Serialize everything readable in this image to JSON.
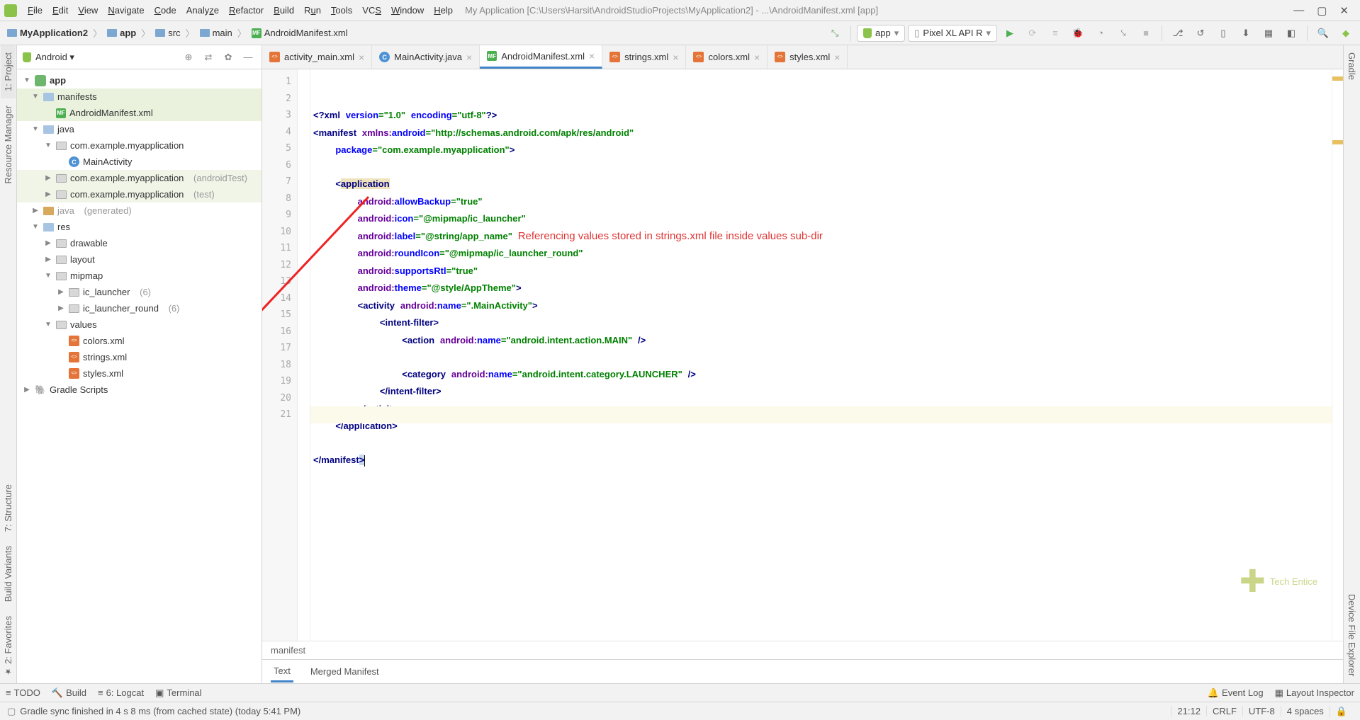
{
  "menu": {
    "items": [
      "File",
      "Edit",
      "View",
      "Navigate",
      "Code",
      "Analyze",
      "Refactor",
      "Build",
      "Run",
      "Tools",
      "VCS",
      "Window",
      "Help"
    ],
    "title": "My Application [C:\\Users\\Harsit\\AndroidStudioProjects\\MyApplication2] - ...\\AndroidManifest.xml [app]"
  },
  "breadcrumb": {
    "items": [
      "MyApplication2",
      "app",
      "src",
      "main",
      "AndroidManifest.xml"
    ]
  },
  "runconfig": {
    "app": "app",
    "device": "Pixel XL API R"
  },
  "left_tabs": {
    "project": "1: Project",
    "resmgr": "Resource Manager",
    "structure": "7: Structure",
    "buildvar": "Build Variants",
    "fav": "2: Favorites"
  },
  "right_tabs": {
    "gradle": "Gradle",
    "devexp": "Device File Explorer"
  },
  "project_panel": {
    "view": "Android"
  },
  "tree": {
    "app": "app",
    "manifests": "manifests",
    "manifest": "AndroidManifest.xml",
    "java": "java",
    "pkg1": "com.example.myapplication",
    "main_act": "MainActivity",
    "pkg2": "com.example.myapplication",
    "pkg2s": "(androidTest)",
    "pkg3": "com.example.myapplication",
    "pkg3s": "(test)",
    "javagen": "java",
    "javagens": "(generated)",
    "res": "res",
    "drawable": "drawable",
    "layout": "layout",
    "mipmap": "mipmap",
    "ic_launcher": "ic_launcher",
    "ic_launcher_s": "(6)",
    "ic_launcher_round": "ic_launcher_round",
    "ic_launcher_round_s": "(6)",
    "values": "values",
    "colors": "colors.xml",
    "strings": "strings.xml",
    "styles": "styles.xml",
    "gradle": "Gradle Scripts"
  },
  "tabs": [
    {
      "label": "activity_main.xml",
      "icon": "xml"
    },
    {
      "label": "MainActivity.java",
      "icon": "c"
    },
    {
      "label": "AndroidManifest.xml",
      "icon": "mf",
      "active": true
    },
    {
      "label": "strings.xml",
      "icon": "xml"
    },
    {
      "label": "colors.xml",
      "icon": "xml"
    },
    {
      "label": "styles.xml",
      "icon": "xml"
    }
  ],
  "code_lines": 21,
  "annotation": "Referencing values stored in strings.xml file inside values sub-dir",
  "editor_bc": "manifest",
  "bottom_tabs": {
    "text": "Text",
    "merged": "Merged Manifest"
  },
  "toolwins": {
    "todo": "TODO",
    "build": "Build",
    "logcat": "6: Logcat",
    "terminal": "Terminal",
    "eventlog": "Event Log",
    "layoutinsp": "Layout Inspector"
  },
  "status": {
    "msg": "Gradle sync finished in 4 s 8 ms (from cached state) (today 5:41 PM)",
    "pos": "21:12",
    "eol": "CRLF",
    "enc": "UTF-8",
    "indent": "4 spaces"
  },
  "watermark": "Tech Entice"
}
